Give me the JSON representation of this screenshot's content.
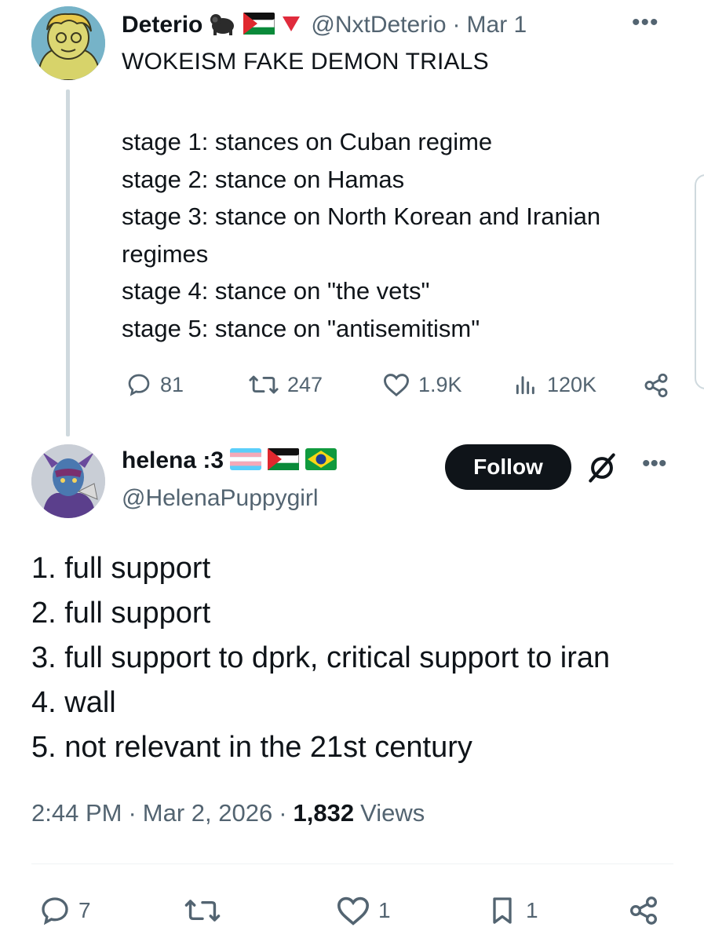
{
  "parent_tweet": {
    "display_name": "Deterio",
    "handle": "@NxtDeterio",
    "date_separator": "·",
    "date": "Mar 1",
    "more": "•••",
    "title": "WOKEISM FAKE DEMON TRIALS",
    "body": "stage 1: stances on Cuban regime\nstage 2: stance on Hamas\nstage 3: stance on North Korean and Iranian regimes\nstage 4: stance on \"the vets\"\nstage 5: stance on \"antisemitism\"",
    "metrics": {
      "replies": "81",
      "reposts": "247",
      "likes": "1.9K",
      "views": "120K"
    },
    "icons": [
      "gorilla-emoji",
      "palestine-flag-icon",
      "red-triangle-icon"
    ]
  },
  "reply_tweet": {
    "display_name": "helena :3",
    "handle": "@HelenaPuppygirl",
    "follow_label": "Follow",
    "more": "•••",
    "body": "1. full support\n2. full support\n3. full support to dprk, critical support to iran\n4. wall\n5. not relevant in the 21st century",
    "time": "2:44 PM",
    "date": "Mar 2, 2026",
    "separator": "·",
    "views_count": "1,832",
    "views_label": "Views",
    "actions": {
      "replies": "7",
      "likes": "1",
      "bookmarks": "1"
    },
    "icons": [
      "trans-flag-icon",
      "palestine-flag-icon",
      "brazil-flag-icon",
      "grok-icon"
    ]
  },
  "colors": {
    "text": "#0f1419",
    "muted": "#536471",
    "divider": "#eff3f4",
    "button": "#0f1419"
  }
}
